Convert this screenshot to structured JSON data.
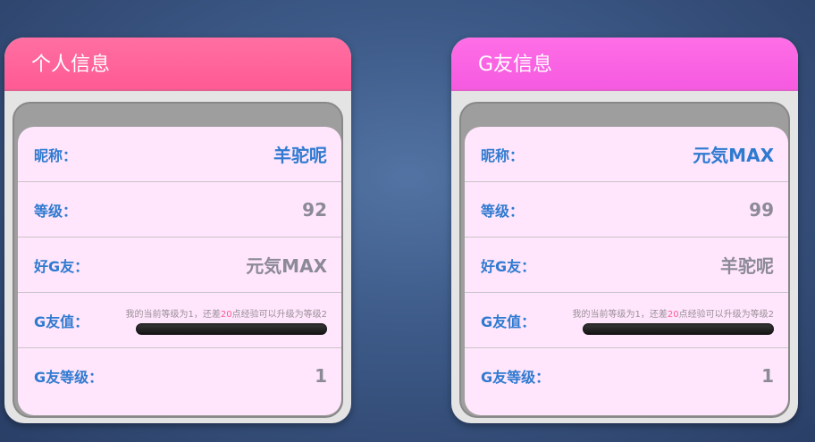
{
  "left_card": {
    "title": "个人信息",
    "nickname_label": "昵称：",
    "nickname": "羊驼呢",
    "level_label": "等级：",
    "level": "92",
    "friend_label": "好G友：",
    "friend": "元気MAX",
    "gvalue_label": "G友值：",
    "progress_prefix": "我的当前等级为1，还差",
    "progress_points": "20",
    "progress_suffix": "点经验可以升级为等级2",
    "progress_fraction": 0,
    "glevel_label": "G友等级：",
    "glevel": "1"
  },
  "right_card": {
    "title": "G友信息",
    "nickname_label": "昵称：",
    "nickname": "元気MAX",
    "level_label": "等级：",
    "level": "99",
    "friend_label": "好G友：",
    "friend": "羊驼呢",
    "gvalue_label": "G友值：",
    "progress_prefix": "我的当前等级为1，还差",
    "progress_points": "20",
    "progress_suffix": "点经验可以升级为等级2",
    "progress_fraction": 0,
    "glevel_label": "G友等级：",
    "glevel": "1"
  }
}
